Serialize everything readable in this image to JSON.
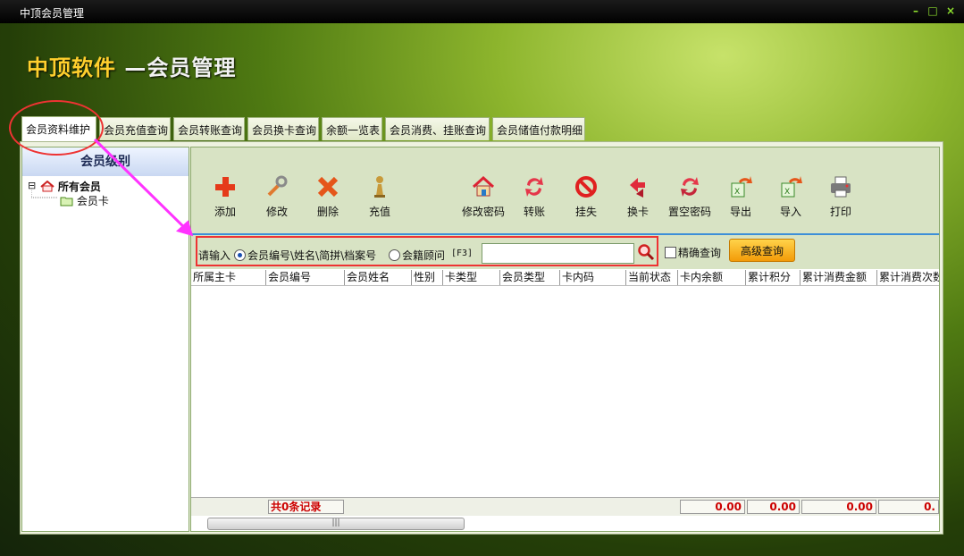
{
  "window": {
    "title": "中顶会员管理",
    "minimize_glyph": "–",
    "restore_glyph": "□",
    "close_glyph": "×"
  },
  "brand": {
    "part1": "中顶软件",
    "part2": " —会员管理"
  },
  "tabs": [
    {
      "label": "会员资料维护",
      "active": true
    },
    {
      "label": "会员充值查询"
    },
    {
      "label": "会员转账查询"
    },
    {
      "label": "会员换卡查询"
    },
    {
      "label": "余额一览表"
    },
    {
      "label": "会员消费、挂账查询"
    },
    {
      "label": "会员储值付款明细"
    }
  ],
  "left": {
    "header": "会员级别",
    "tree_root": "所有会员",
    "tree_child": "会员卡",
    "expander": "⊟"
  },
  "toolbar": [
    {
      "label": "添加",
      "icon": "plus-icon"
    },
    {
      "label": "修改",
      "icon": "wrench-icon"
    },
    {
      "label": "删除",
      "icon": "x-icon"
    },
    {
      "label": "充值",
      "icon": "pawn-icon"
    },
    {
      "label": "修改密码",
      "icon": "house-icon"
    },
    {
      "label": "转账",
      "icon": "transfer-icon"
    },
    {
      "label": "挂失",
      "icon": "forbidden-icon"
    },
    {
      "label": "换卡",
      "icon": "swap-card-icon"
    },
    {
      "label": "置空密码",
      "icon": "reset-password-icon"
    },
    {
      "label": "导出",
      "icon": "export-icon"
    },
    {
      "label": "导入",
      "icon": "import-icon"
    },
    {
      "label": "打印",
      "icon": "printer-icon"
    }
  ],
  "search": {
    "prompt": "请输入",
    "option1": "会员编号\\姓名\\简拼\\档案号",
    "option2": "会籍顾问",
    "hotkey": "[F3]",
    "value": "",
    "exact_label": "精确查询",
    "advanced_label": "高级查询"
  },
  "columns": [
    "所属主卡",
    "会员编号",
    "会员姓名",
    "性别",
    "卡类型",
    "会员类型",
    "卡内码",
    "当前状态",
    "卡内余额",
    "累计积分",
    "累计消费金额",
    "累计消费次数"
  ],
  "footer": {
    "record_count": "共0条记录",
    "total_balance": "0.00",
    "total_points": "0.00",
    "total_spend": "0.00",
    "total_count": "0.",
    "scroll_grip": "|||"
  },
  "colors": {
    "highlight": "#ee3333",
    "arrow": "#ff33ff",
    "brand_gold": "#ffcf2d"
  }
}
